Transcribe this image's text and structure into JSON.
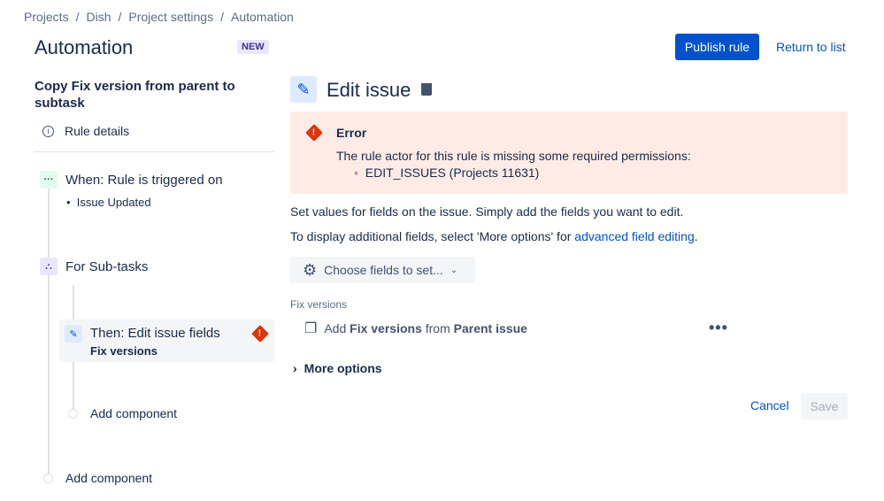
{
  "breadcrumb": [
    "Projects",
    "Dish",
    "Project settings",
    "Automation"
  ],
  "header": {
    "title": "Automation",
    "badge": "NEW",
    "publish": "Publish rule",
    "return": "Return to list"
  },
  "sidebar": {
    "rule_name": "Copy Fix version from parent to subtask",
    "rule_details": "Rule details",
    "trigger": {
      "label": "When: Rule is triggered on",
      "item": "Issue Updated"
    },
    "branch": "For Sub-tasks",
    "action": {
      "label": "Then: Edit issue fields",
      "sub": "Fix versions"
    },
    "add_inner": "Add component",
    "add_outer": "Add component"
  },
  "main": {
    "title": "Edit issue",
    "error": {
      "title": "Error",
      "message": "The rule actor for this rule is missing some required permissions:",
      "item": "EDIT_ISSUES (Projects 11631)"
    },
    "desc1": "Set values for fields on the issue. Simply add the fields you want to edit.",
    "desc2": "To display additional fields, select 'More options' for ",
    "desc2_link": "advanced field editing",
    "desc2_end": ".",
    "choose": "Choose fields to set...",
    "field_label": "Fix versions",
    "field_row": {
      "pre": "Add ",
      "b1": "Fix versions",
      "mid": " from ",
      "b2": "Parent issue"
    },
    "more": "More options",
    "cancel": "Cancel",
    "save": "Save"
  }
}
